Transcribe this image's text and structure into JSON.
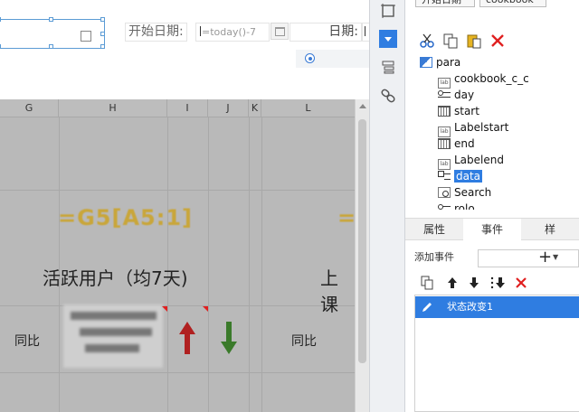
{
  "param_form": {
    "label_start": "开始日期:",
    "start_formula": "=today()-7",
    "label_date": "日期:"
  },
  "columns": [
    "G",
    "H",
    "I",
    "J",
    "K",
    "L"
  ],
  "sheet": {
    "formula_left": "=G5[A5:1]",
    "formula_right": "=",
    "active_users": "活跃用户（均7天)",
    "right_label": "上课",
    "yoy_left": "同比",
    "yoy_right": "同比",
    "up_arrow_color": "#b02020",
    "down_arrow_color": "#3a7a2a"
  },
  "top_buttons": [
    "开始日期",
    "cookbook"
  ],
  "toolstrip_icons": [
    "rectangle-icon",
    "dropdown-icon",
    "layers-icon",
    "link-icon"
  ],
  "tree": {
    "root": "para",
    "items": [
      {
        "label": "cookbook_c_c",
        "icon": "label-icon"
      },
      {
        "label": "day",
        "icon": "radio-group-icon"
      },
      {
        "label": "start",
        "icon": "calendar-icon"
      },
      {
        "label": "Labelstart",
        "icon": "label-icon"
      },
      {
        "label": "end",
        "icon": "calendar-icon"
      },
      {
        "label": "Labelend",
        "icon": "label-icon"
      },
      {
        "label": "data",
        "icon": "checkbox-group-icon",
        "selected": true
      },
      {
        "label": "Search",
        "icon": "search-icon"
      },
      {
        "label": "rolo",
        "icon": "radio-group-icon"
      }
    ]
  },
  "tabs": [
    "属性",
    "事件",
    "样"
  ],
  "active_tab": "事件",
  "events": {
    "add_label": "添加事件",
    "items": [
      "状态改变1"
    ]
  },
  "colors": {
    "accent": "#2f7de1",
    "delete": "#e02020",
    "formula_gold": "#c9a63a"
  }
}
